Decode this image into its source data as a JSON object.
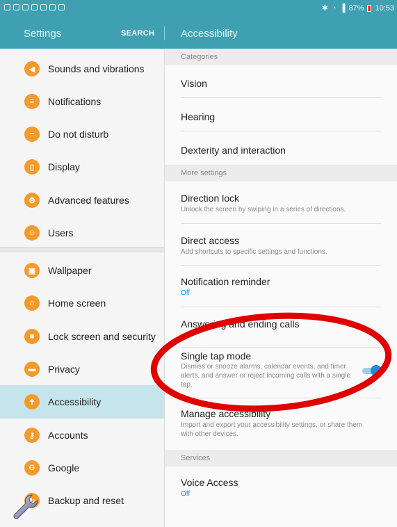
{
  "status_bar": {
    "battery_percent": "87%",
    "time": "10:53",
    "icons": [
      "notification-icon",
      "check-icon",
      "screenshot-icon",
      "mail-icon",
      "gallery-icon",
      "headphone-icon",
      "headphone-icon",
      "bluetooth-icon",
      "wifi-icon",
      "signal-icon",
      "battery-icon"
    ]
  },
  "header": {
    "left_title": "Settings",
    "search_label": "SEARCH",
    "right_title": "Accessibility"
  },
  "sidebar": {
    "items": [
      {
        "label": "Sounds and vibrations",
        "icon": "speaker-icon"
      },
      {
        "label": "Notifications",
        "icon": "notifications-icon"
      },
      {
        "label": "Do not disturb",
        "icon": "minus-circle-icon"
      },
      {
        "label": "Display",
        "icon": "display-icon"
      },
      {
        "label": "Advanced features",
        "icon": "advanced-features-icon"
      },
      {
        "label": "Users",
        "icon": "users-icon"
      },
      {
        "label": "Wallpaper",
        "icon": "wallpaper-icon"
      },
      {
        "label": "Home screen",
        "icon": "home-icon"
      },
      {
        "label": "Lock screen and security",
        "icon": "lock-icon"
      },
      {
        "label": "Privacy",
        "icon": "privacy-icon"
      },
      {
        "label": "Accessibility",
        "icon": "accessibility-icon",
        "selected": true
      },
      {
        "label": "Accounts",
        "icon": "key-icon"
      },
      {
        "label": "Google",
        "icon": "google-icon"
      },
      {
        "label": "Backup and reset",
        "icon": "backup-icon"
      }
    ],
    "accent_color": "#f49a2a",
    "selected_bg": "#c6e4ec"
  },
  "main": {
    "sections": [
      {
        "header": "Categories",
        "rows": [
          {
            "title": "Vision"
          },
          {
            "title": "Hearing"
          },
          {
            "title": "Dexterity and interaction"
          }
        ]
      },
      {
        "header": "More settings",
        "rows": [
          {
            "title": "Direction lock",
            "subtitle": "Unlock the screen by swiping in a series of directions."
          },
          {
            "title": "Direct access",
            "subtitle": "Add shortcuts to specific settings and functions."
          },
          {
            "title": "Notification reminder",
            "subtitle": "Off"
          },
          {
            "title": "Answering and ending calls"
          },
          {
            "title": "Single tap mode",
            "subtitle": "Dismiss or snooze alarms, calendar events, and timer alerts, and answer or reject incoming calls with a single tap.",
            "toggle_on": true
          },
          {
            "title": "Manage accessibility",
            "subtitle": "Import and export your accessibility settings, or share them with other devices."
          }
        ]
      },
      {
        "header": "Services",
        "rows": [
          {
            "title": "Voice Access",
            "subtitle": "Off"
          }
        ]
      }
    ]
  },
  "colors": {
    "header_bg": "#3fa0b2",
    "toggle_on": "#1f8fd6",
    "link_blue": "#2a8bd0",
    "annotation_red": "#e00000"
  }
}
